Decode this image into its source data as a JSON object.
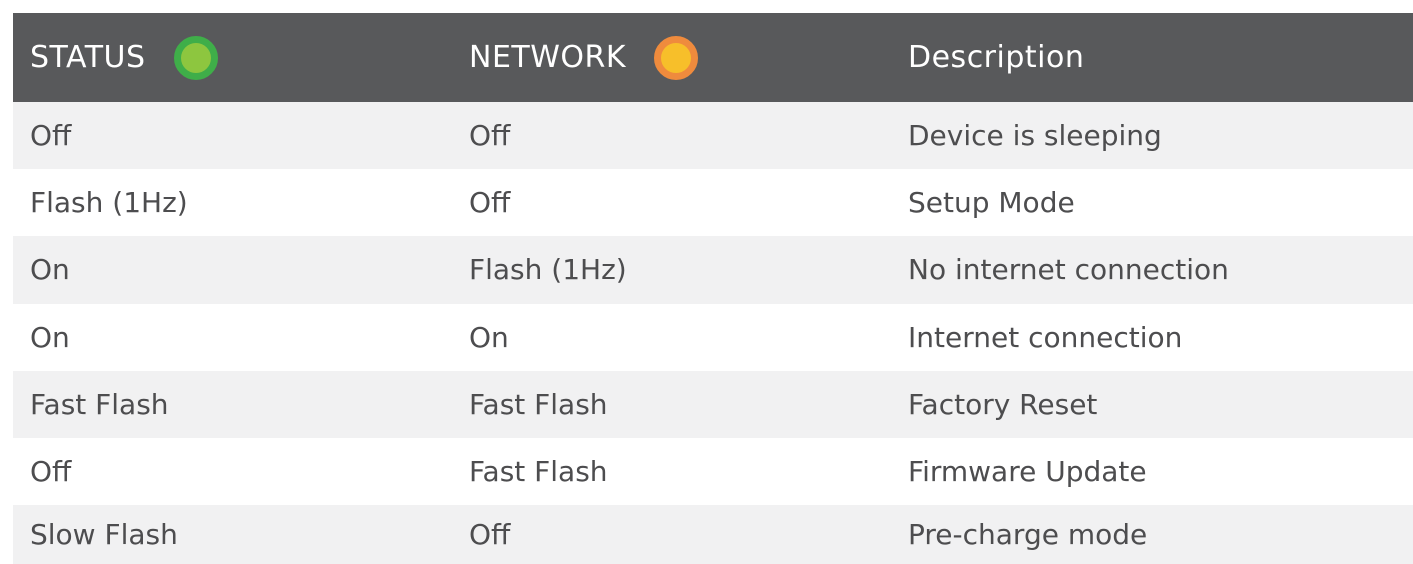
{
  "header": {
    "status_label": "STATUS",
    "network_label": "NETWORK",
    "description_label": "Description",
    "status_led_color": "#8dc63f",
    "network_led_color": "#f7bf2a"
  },
  "rows": [
    {
      "status": "Off",
      "network": "Off",
      "description": "Device is sleeping"
    },
    {
      "status": "Flash (1Hz)",
      "network": "Off",
      "description": "Setup Mode"
    },
    {
      "status": "On",
      "network": "Flash (1Hz)",
      "description": "No internet connection"
    },
    {
      "status": "On",
      "network": "On",
      "description": "Internet connection"
    },
    {
      "status": "Fast Flash",
      "network": "Fast Flash",
      "description": "Factory Reset"
    },
    {
      "status": "Off",
      "network": "Fast Flash",
      "description": "Firmware Update"
    },
    {
      "status": "Slow Flash",
      "network": "Off",
      "description": "Pre-charge mode"
    }
  ]
}
